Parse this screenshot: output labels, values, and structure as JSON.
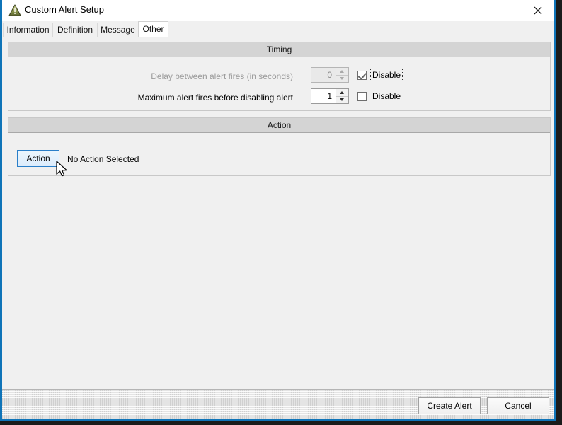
{
  "window": {
    "title": "Custom Alert Setup",
    "icon": "warning-triangle-icon",
    "close_label": "×",
    "accent_border": "#0f74b8"
  },
  "tabs": {
    "items": [
      {
        "label": "Information",
        "active": false
      },
      {
        "label": "Definition",
        "active": false
      },
      {
        "label": "Message",
        "active": false
      },
      {
        "label": "Other",
        "active": true
      }
    ],
    "scroll_left_icon": "double-chevron-left-icon"
  },
  "timing_group": {
    "title": "Timing",
    "rows": [
      {
        "label": "Delay between alert fires (in seconds)",
        "value": "0",
        "disabled": true,
        "checkbox_label": "Disable",
        "checked": true,
        "focused": true
      },
      {
        "label": "Maximum alert fires before disabling alert",
        "value": "1",
        "disabled": false,
        "checkbox_label": "Disable",
        "checked": false,
        "focused": false
      }
    ]
  },
  "action_group": {
    "title": "Action",
    "button_label": "Action",
    "status_text": "No Action Selected"
  },
  "footer": {
    "primary_label": "Create Alert",
    "secondary_label": "Cancel"
  }
}
